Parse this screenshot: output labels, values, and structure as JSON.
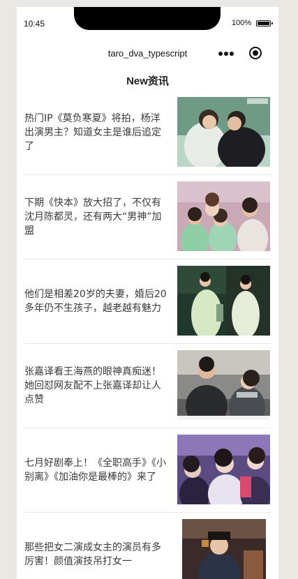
{
  "status_bar": {
    "time": "10:45",
    "battery": "100%"
  },
  "nav_bar": {
    "title": "taro_dva_typescript"
  },
  "page": {
    "header": "New资讯"
  },
  "news": [
    {
      "title": "热门IP《莫负寒夏》将拍，杨洋出演男主？知道女主是谁后追定了"
    },
    {
      "title": "下期《快本》放大招了，不仅有沈月陈都灵，还有两大“男神”加盟"
    },
    {
      "title": "他们是相差20岁的夫妻，婚后20多年仍不生孩子，越老越有魅力"
    },
    {
      "title": "张嘉译看王海燕的眼神真痴迷！她回怼网友配不上张嘉译却让人点赞"
    },
    {
      "title": "七月好剧奉上！《全职高手》《小别离》《加油你是最棒的》来了"
    },
    {
      "title": "那些把女二演成女主的演员有多厉害！颜值演技吊打女一"
    }
  ]
}
